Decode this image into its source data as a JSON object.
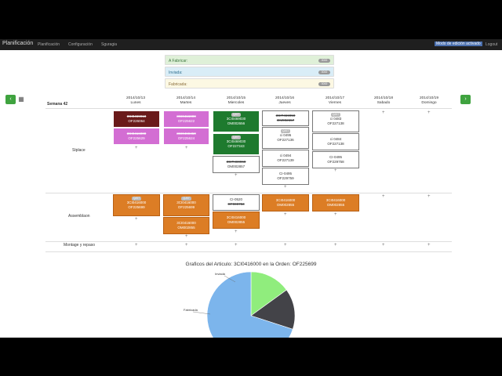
{
  "navbar": {
    "brand": "Planificación",
    "links": [
      "Planificación",
      "Configuración",
      "Sguragia"
    ],
    "mode": "Modo de edición activado",
    "logout": "Logout"
  },
  "summary": [
    {
      "label": "A Fabricar:",
      "count": "0000"
    },
    {
      "label": "Inviada:",
      "count": "0000"
    },
    {
      "label": "Fabricada:",
      "count": "0000"
    }
  ],
  "week_label": "Semana 42",
  "days": [
    {
      "date": "2014/10/13",
      "name": "Lunes"
    },
    {
      "date": "2014/10/14",
      "name": "Martes"
    },
    {
      "date": "2014/10/15",
      "name": "Miercoles"
    },
    {
      "date": "2014/10/16",
      "name": "Jueves"
    },
    {
      "date": "2014/10/17",
      "name": "Viernes"
    },
    {
      "date": "2014/10/18",
      "name": "Sabado"
    },
    {
      "date": "2014/10/19",
      "name": "Domingo"
    }
  ],
  "rows": [
    "Stplace",
    "Assemblaon",
    "Montage y repaso"
  ],
  "cards": {
    "mon1": {
      "badge": "",
      "line1": "3CI0469910",
      "line2": "OF226064"
    },
    "mon2": {
      "badge": "",
      "line1": "3CI0416000",
      "line2": "OF225629"
    },
    "tue1": {
      "badge": "",
      "line1": "3CI0416000",
      "line2": "OF225622"
    },
    "tue2": {
      "badge": "",
      "line1": "3CI0469450",
      "line2": "OF225624"
    },
    "wed1": {
      "badge": "QJ07",
      "line1": "3CI0469030",
      "line2": "OM002656"
    },
    "wed2": {
      "badge": "QJ07",
      "line1": "3CI0469030",
      "line2": "OF227343"
    },
    "wed3": {
      "badge": "",
      "line1": "3CIT469060",
      "line2": "OM002857"
    },
    "thu1": {
      "badge": "",
      "line1": "3CIT469050",
      "line2": "OM002657"
    },
    "thu2": {
      "badge": "QJ07",
      "line1": "ci 0495",
      "line2": "OF227136"
    },
    "thu3": {
      "badge": "",
      "line1": "ci 0494",
      "line2": "OF227139"
    },
    "thu4": {
      "badge": "",
      "line1": "CI-0495",
      "line2": "OF229759"
    },
    "fri1": {
      "badge": "QJ07",
      "line1": "ci 0483",
      "line2": "OF227138"
    },
    "fri2": {
      "badge": "",
      "line1": "ci 0484",
      "line2": "OF227138"
    },
    "fri3": {
      "badge": "",
      "line1": "CI-0495",
      "line2": "OF229758"
    },
    "amon1": {
      "badge": "QJ07",
      "line1": "3CI0416000",
      "line2": "OF225699"
    },
    "atue1": {
      "badge": "QJ07",
      "line1": "3CI0416000",
      "line2": "OF225699"
    },
    "atue2": {
      "badge": "",
      "line1": "3CI0416000",
      "line2": "OM002855"
    },
    "awed1": {
      "badge": "",
      "line1": "CI-0520",
      "line2": "OF000753"
    },
    "awed2": {
      "badge": "",
      "line1": "3CI0416000",
      "line2": "OM002855"
    },
    "athu1": {
      "badge": "",
      "line1": "3CI0416000",
      "line2": "OM002855"
    },
    "afri1": {
      "badge": "",
      "line1": "3CI0416000",
      "line2": "OM002855"
    }
  },
  "chart": {
    "title": "Graficos del Articulo: 3CI0416000 en la Orden: OF225699",
    "slice_labels": [
      "Inviada",
      "Fabricada"
    ]
  },
  "chart_data": {
    "type": "pie",
    "title": "Graficos del Articulo: 3CI0416000 en la Orden: OF225699",
    "categories": [
      "Inviada",
      "Fabricada",
      "A Fabricar"
    ],
    "values": [
      15,
      15,
      70
    ],
    "colors": [
      "#90ed7d",
      "#434348",
      "#7cb5ec"
    ]
  }
}
